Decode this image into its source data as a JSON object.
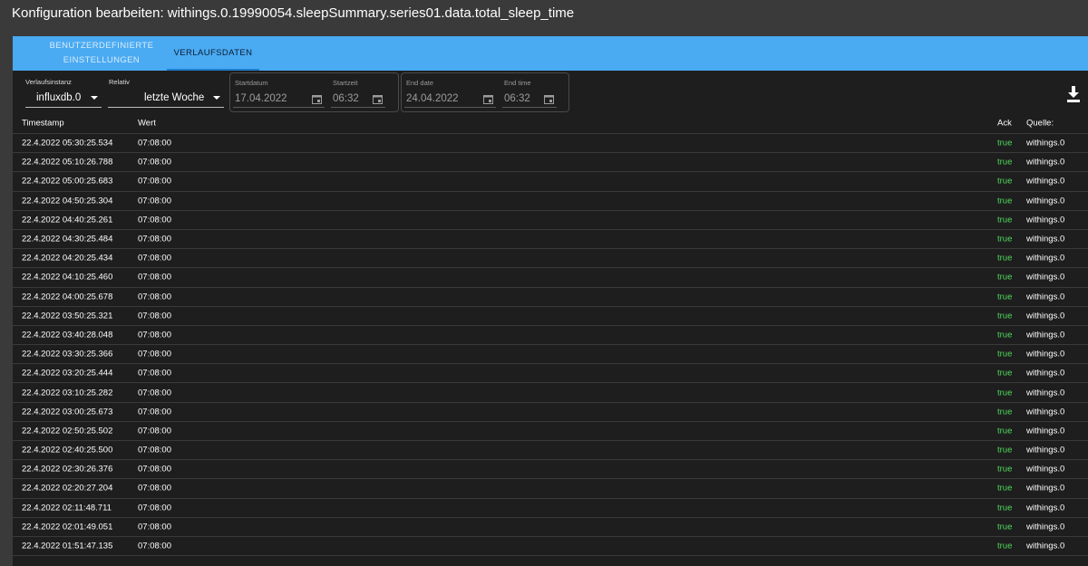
{
  "window": {
    "title": "Konfiguration bearbeiten: withings.0.19990054.sleepSummary.series01.data.total_sleep_time"
  },
  "tabs": [
    {
      "label": "BENUTZERDEFINIERTE EINSTELLUNGEN",
      "line1": "BENUTZERDEFINIERTE",
      "line2": "EINSTELLUNGEN",
      "active": false
    },
    {
      "label": "VERLAUFSDATEN",
      "active": true
    }
  ],
  "controls": {
    "instance": {
      "label": "Verlaufsinstanz",
      "value": "influxdb.0"
    },
    "relative": {
      "label": "Relativ",
      "value": "letzte Woche"
    },
    "start_date": {
      "label": "Startdatum",
      "value": "17.04.2022"
    },
    "start_time": {
      "label": "Startzeit",
      "value": "06:32"
    },
    "end_date": {
      "label": "End date",
      "value": "24.04.2022"
    },
    "end_time": {
      "label": "End time",
      "value": "06:32"
    },
    "download_icon": "download-icon"
  },
  "table": {
    "headers": {
      "timestamp": "Timestamp",
      "value": "Wert",
      "ack": "Ack",
      "source": "Quelle:"
    },
    "rows": [
      {
        "timestamp": "22.4.2022 05:30:25.534",
        "value": "07:08:00",
        "ack": "true",
        "source": "withings.0"
      },
      {
        "timestamp": "22.4.2022 05:10:26.788",
        "value": "07:08:00",
        "ack": "true",
        "source": "withings.0"
      },
      {
        "timestamp": "22.4.2022 05:00:25.683",
        "value": "07:08:00",
        "ack": "true",
        "source": "withings.0"
      },
      {
        "timestamp": "22.4.2022 04:50:25.304",
        "value": "07:08:00",
        "ack": "true",
        "source": "withings.0"
      },
      {
        "timestamp": "22.4.2022 04:40:25.261",
        "value": "07:08:00",
        "ack": "true",
        "source": "withings.0"
      },
      {
        "timestamp": "22.4.2022 04:30:25.484",
        "value": "07:08:00",
        "ack": "true",
        "source": "withings.0"
      },
      {
        "timestamp": "22.4.2022 04:20:25.434",
        "value": "07:08:00",
        "ack": "true",
        "source": "withings.0"
      },
      {
        "timestamp": "22.4.2022 04:10:25.460",
        "value": "07:08:00",
        "ack": "true",
        "source": "withings.0"
      },
      {
        "timestamp": "22.4.2022 04:00:25.678",
        "value": "07:08:00",
        "ack": "true",
        "source": "withings.0"
      },
      {
        "timestamp": "22.4.2022 03:50:25.321",
        "value": "07:08:00",
        "ack": "true",
        "source": "withings.0"
      },
      {
        "timestamp": "22.4.2022 03:40:28.048",
        "value": "07:08:00",
        "ack": "true",
        "source": "withings.0"
      },
      {
        "timestamp": "22.4.2022 03:30:25.366",
        "value": "07:08:00",
        "ack": "true",
        "source": "withings.0"
      },
      {
        "timestamp": "22.4.2022 03:20:25.444",
        "value": "07:08:00",
        "ack": "true",
        "source": "withings.0"
      },
      {
        "timestamp": "22.4.2022 03:10:25.282",
        "value": "07:08:00",
        "ack": "true",
        "source": "withings.0"
      },
      {
        "timestamp": "22.4.2022 03:00:25.673",
        "value": "07:08:00",
        "ack": "true",
        "source": "withings.0"
      },
      {
        "timestamp": "22.4.2022 02:50:25.502",
        "value": "07:08:00",
        "ack": "true",
        "source": "withings.0"
      },
      {
        "timestamp": "22.4.2022 02:40:25.500",
        "value": "07:08:00",
        "ack": "true",
        "source": "withings.0"
      },
      {
        "timestamp": "22.4.2022 02:30:26.376",
        "value": "07:08:00",
        "ack": "true",
        "source": "withings.0"
      },
      {
        "timestamp": "22.4.2022 02:20:27.204",
        "value": "07:08:00",
        "ack": "true",
        "source": "withings.0"
      },
      {
        "timestamp": "22.4.2022 02:11:48.711",
        "value": "07:08:00",
        "ack": "true",
        "source": "withings.0"
      },
      {
        "timestamp": "22.4.2022 02:01:49.051",
        "value": "07:08:00",
        "ack": "true",
        "source": "withings.0"
      },
      {
        "timestamp": "22.4.2022 01:51:47.135",
        "value": "07:08:00",
        "ack": "true",
        "source": "withings.0"
      }
    ]
  },
  "colors": {
    "tab_bar": "#4aaaf2",
    "ack_true": "#4fdb5c",
    "background": "#1e1e1e"
  }
}
